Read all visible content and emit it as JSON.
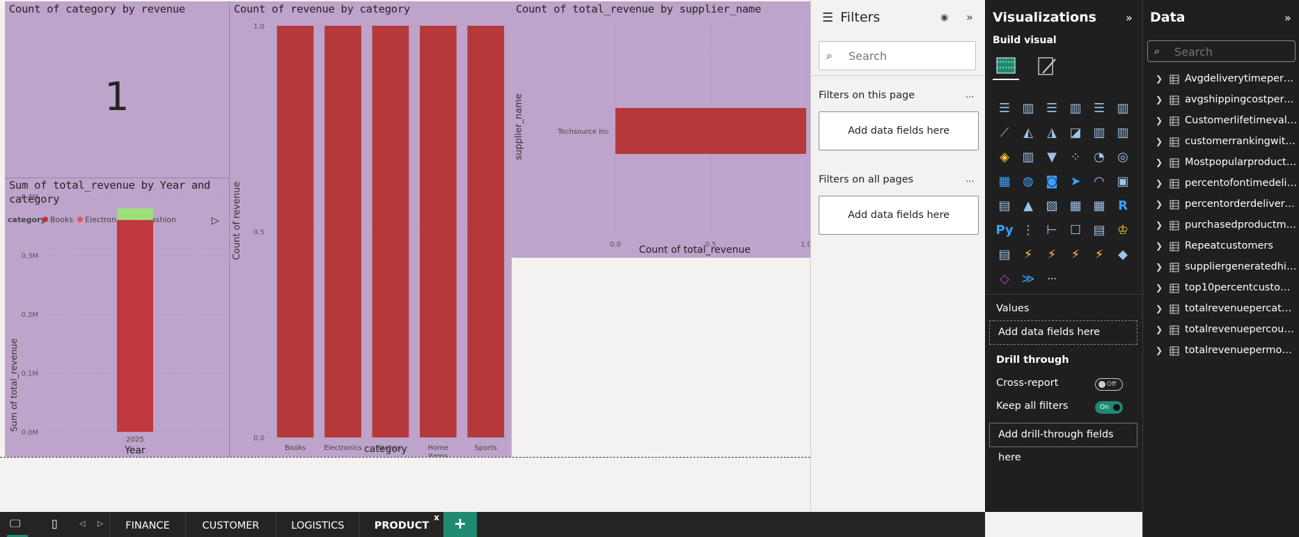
{
  "visuals": {
    "card": {
      "title": "Count of category by revenue",
      "value": "1"
    },
    "stacked": {
      "title_line1": "Sum of total_revenue by Year and",
      "title_line2": "category",
      "legend_title": "category",
      "legend": [
        "Books",
        "Electronics",
        "Fashion"
      ],
      "ylabel": "Sum of total_revenue",
      "xlabel": "Year",
      "yticks": [
        "0.4M",
        "0.3M",
        "0.2M",
        "0.1M",
        "0.0M"
      ]
    },
    "bar": {
      "title": "Count of revenue by category",
      "ylabel": "Count of revenue",
      "xlabel": "category",
      "yticks": [
        "1.0",
        "0.5",
        "0.0"
      ]
    },
    "hbar": {
      "title": "Count of total_revenue by supplier_name",
      "ylabel": "supplier_name",
      "xlabel": "Count of total_revenue",
      "xticks": [
        "0.0",
        "0.5",
        "1.0"
      ]
    }
  },
  "chart_data": [
    {
      "type": "bar",
      "title": "Sum of total_revenue by Year and category",
      "categories": [
        "2025"
      ],
      "series": [
        {
          "name": "Books",
          "values": [
            0.36
          ]
        },
        {
          "name": "Electronics",
          "values": [
            0.0
          ]
        },
        {
          "name": "Fashion",
          "values": [
            0.02
          ]
        }
      ],
      "colors": [
        "#c0393d",
        "#ee5454",
        "#9cde7a"
      ],
      "xlabel": "Year",
      "ylabel": "Sum of total_revenue",
      "ylim": [
        0,
        0.4
      ],
      "unit": "M",
      "stacked": true
    },
    {
      "type": "bar",
      "title": "Count of revenue by category",
      "categories": [
        "Books",
        "Electronics",
        "Fashion",
        "Home Items",
        "Sports"
      ],
      "values": [
        1,
        1,
        1,
        1,
        1
      ],
      "color": "#b5393a",
      "xlabel": "category",
      "ylabel": "Count of revenue",
      "ylim": [
        0,
        1
      ]
    },
    {
      "type": "bar",
      "orientation": "horizontal",
      "title": "Count of total_revenue by supplier_name",
      "categories": [
        "Techsource Inc"
      ],
      "values": [
        1
      ],
      "color": "#b5393a",
      "xlabel": "Count of total_revenue",
      "ylabel": "supplier_name",
      "xlim": [
        0,
        1
      ]
    }
  ],
  "filters": {
    "title": "Filters",
    "search_placeholder": "Search",
    "on_this_page": "Filters on this page",
    "on_all_pages": "Filters on all pages",
    "add_fields": "Add data fields here",
    "more": "..."
  },
  "viz": {
    "title": "Visualizations",
    "build_visual": "Build visual",
    "values_label": "Values",
    "add_data_fields": "Add data fields here",
    "drill_through": "Drill through",
    "cross_report": "Cross-report",
    "cross_report_state": "Off",
    "keep_filters": "Keep all filters",
    "keep_filters_state": "On",
    "add_drill": "Add drill-through fields here",
    "icons": [
      "stacked-bar-icon",
      "clustered-column-icon",
      "clustered-bar-icon",
      "stacked-column-icon",
      "100-bar-icon",
      "100-column-icon",
      "line-chart-icon",
      "area-chart-icon",
      "stacked-area-icon",
      "ribbon-icon",
      "line-column-icon",
      "line-stacked-icon",
      "waterfall-icon",
      "column-chart-icon",
      "funnel-icon",
      "scatter-icon",
      "pie-icon",
      "donut-icon",
      "treemap-icon",
      "map-icon",
      "filled-map-icon",
      "azure-map-icon",
      "gauge-icon",
      "card-icon",
      "multirow-card-icon",
      "kpi-icon",
      "slicer-icon",
      "table-icon",
      "matrix-icon",
      "r-visual-icon",
      "python-visual-icon",
      "key-influencers-icon",
      "decomposition-tree-icon",
      "qa-icon",
      "narrative-icon",
      "trophy-icon",
      "paginated-report-icon",
      "power-apps-icon",
      "power-automate-icon",
      "metrics-icon",
      "goals-icon",
      "arcgis-icon",
      "powerapps-diamond-icon",
      "automate-arrow-icon",
      "more-visuals-icon"
    ]
  },
  "data": {
    "title": "Data",
    "search_placeholder": "Search",
    "tables": [
      "Avgdeliverytimepercar...",
      "avgshippingcostpercu...",
      "Customerlifetimevalue...",
      "customerrankingwithe...",
      "Mostpopularproductc...",
      "percentofontimedeliv...",
      "percentorderdelivered...",
      "purchasedproductmor...",
      "Repeatcustomers",
      "suppliergeneratedhig...",
      "top10percentcustome...",
      "totalrevenuepercateg...",
      "totalrevenuepercountr...",
      "totalrevenuepermonth..."
    ]
  },
  "tabs": {
    "pages": [
      "FINANCE",
      "CUSTOMER",
      "LOGISTICS",
      "PRODUCT"
    ],
    "active": "PRODUCT",
    "close": "x",
    "add": "+"
  }
}
